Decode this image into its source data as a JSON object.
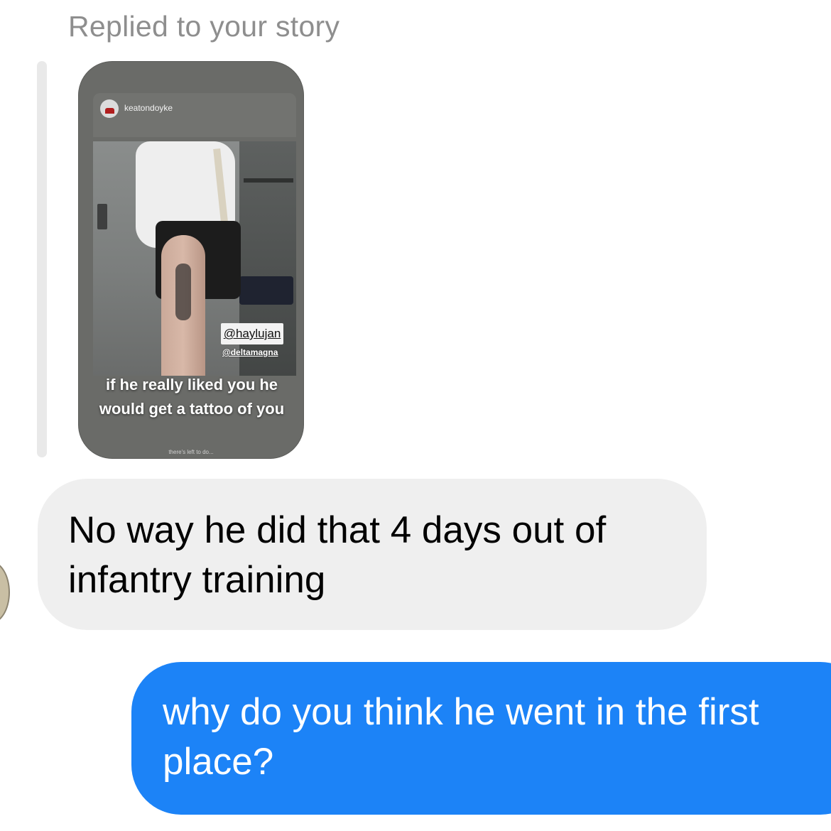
{
  "reply_header": {
    "label": "Replied to your story"
  },
  "story": {
    "username": "keatondoyke",
    "mention_primary": "@haylujan",
    "mention_secondary": "@deltamagna",
    "caption": "if he really liked you he would get a tattoo of you",
    "footer": "there's left to do..."
  },
  "messages": [
    {
      "direction": "received",
      "text": "No way he did that 4 days out of infantry training"
    },
    {
      "direction": "sent",
      "text": "why do you think he went in the first place?"
    }
  ],
  "colors": {
    "sent_bubble": "#1c83f7",
    "received_bubble": "#efefef",
    "muted_text": "#8e8e8e"
  }
}
